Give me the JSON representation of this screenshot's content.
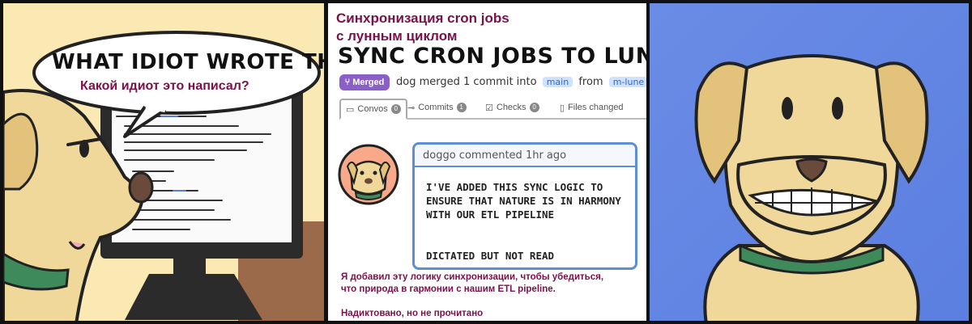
{
  "panel1": {
    "speech_en": "WHAT IDIOT WROTE THIS?",
    "speech_ru": "Какой идиот это написал?"
  },
  "panel2": {
    "title_ru_line1": "Синхронизация cron jobs",
    "title_ru_line2": "с лунным циклом",
    "title_en": "SYNC CRON JOBS TO LUNAR CYCLE",
    "badge": "Merged",
    "merged_text": "dog merged 1 commit into",
    "from_text": "from",
    "tabs": [
      {
        "label": "Convos",
        "count": "0"
      },
      {
        "label": "Commits",
        "count": "1"
      },
      {
        "label": "Checks",
        "count": "0"
      },
      {
        "label": "Files changed",
        "count": ""
      }
    ],
    "comment_author": "doggo commented 1hr ago",
    "comment_body": "I'VE ADDED THIS SYNC LOGIC TO ENSURE THAT NATURE IS IN HARMONY WITH OUR ETL PIPELINE",
    "comment_sig": "DICTATED BUT NOT READ",
    "translation_line1": "Я добавил эту логику синхронизации, чтобы убедиться,",
    "translation_line2": "что природа в гармонии с нашим ETL pipeline.",
    "translation_line3": "Надиктовано, но не прочитано"
  },
  "colors": {
    "accent_russian": "#7a1148",
    "merged_purple": "#8a5fc8",
    "comment_blue": "#5d8ed6",
    "dog_fur": "#f0d89a",
    "collar_green": "#3f8a5a",
    "panel3_bg": "#5b7fe0"
  }
}
